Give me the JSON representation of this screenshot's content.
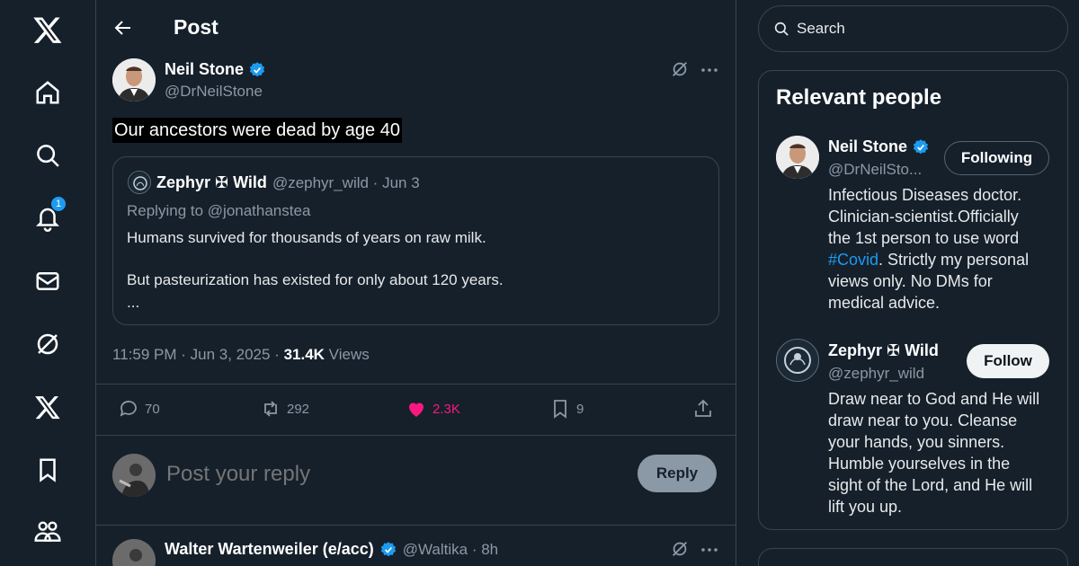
{
  "colors": {
    "background": "#15202b",
    "accent": "#1d9bf0",
    "like": "#f91880",
    "muted": "#8b98a5",
    "border": "#38444d"
  },
  "nav": {
    "notification_count": "1",
    "items": [
      "x-logo-icon",
      "home-icon",
      "search-icon",
      "bell-icon",
      "mail-icon",
      "grok-icon",
      "x-premium-icon",
      "bookmark-icon",
      "communities-icon"
    ]
  },
  "header": {
    "title": "Post"
  },
  "post": {
    "author_name": "Neil Stone",
    "author_handle": "@DrNeilStone",
    "text": "Our ancestors were dead by age 40",
    "timestamp": "11:59 PM · Jun 3, 2025 · ",
    "views_count": "31.4K",
    "views_label": " Views",
    "quote": {
      "name": "Zephyr ✠ Wild",
      "meta": "@zephyr_wild · Jun 3",
      "replying_prefix": "Replying to ",
      "replying_to": "@jonathanstea",
      "line1": "Humans survived for thousands of years on raw milk.",
      "line2": "But pasteurization has existed for only about 120 years.",
      "line3": "..."
    },
    "actions": {
      "replies": "70",
      "reposts": "292",
      "likes": "2.3K",
      "bookmarks": "9"
    }
  },
  "reply": {
    "placeholder": "Post your reply",
    "button": "Reply"
  },
  "next_post": {
    "author_name": "Walter Wartenweiler (e/acc)",
    "meta": "@Waltika · 8h"
  },
  "sidebar": {
    "search_placeholder": "Search",
    "panel_title": "Relevant people",
    "people": [
      {
        "name": "Neil Stone",
        "handle": "@DrNeilSto...",
        "button": "Following",
        "bio_lines": [
          "Infectious Diseases doctor.",
          "Clinician-scientist.Officially",
          "the 1st person to use word",
          "#Covid",
          ". Strictly my personal",
          "views only. No DMs for",
          "medical advice."
        ]
      },
      {
        "name": "Zephyr ✠ Wild",
        "handle": "@zephyr_wild",
        "button": "Follow",
        "bio_lines": [
          "Draw near to God and He will",
          "draw near to you. Cleanse",
          "your hands, you sinners.",
          "Humble yourselves in the",
          "sight of the Lord, and He will",
          "lift you up."
        ]
      }
    ]
  }
}
